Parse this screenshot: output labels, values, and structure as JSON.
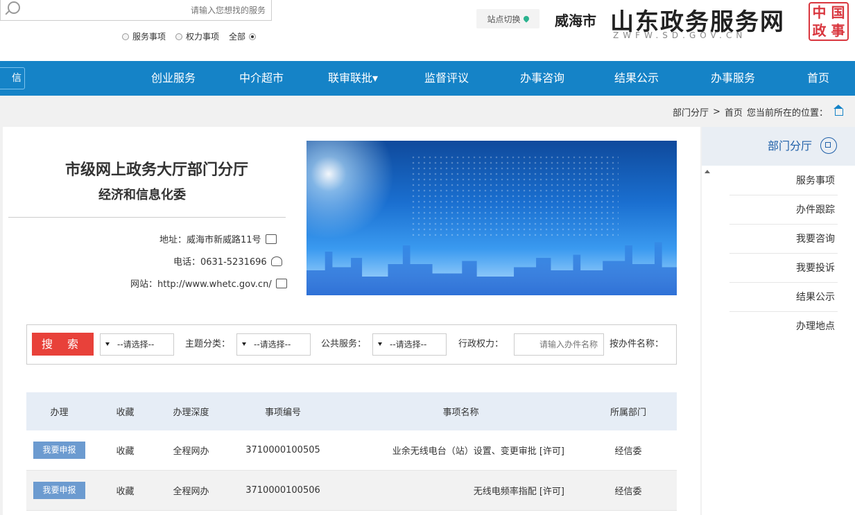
{
  "header": {
    "logo_title": "山东政务服务网",
    "logo_sub": "ZWFW.SD.GOV.CN",
    "seal_chars": [
      "中",
      "国",
      "政",
      "事"
    ],
    "city": "威海市",
    "switch_label": "站点切换",
    "search_placeholder": "请输入您想找的服务",
    "radios": [
      {
        "label": "全部",
        "checked": true
      },
      {
        "label": "权力事项",
        "checked": false
      },
      {
        "label": "服务事项",
        "checked": false
      }
    ]
  },
  "nav": {
    "items": [
      "首页",
      "办事服务",
      "结果公示",
      "办事咨询",
      "监督评议",
      "联审联批▾",
      "中介超市",
      "创业服务"
    ],
    "extra": "信"
  },
  "breadcrumb": {
    "prefix": "您当前所在的位置：",
    "home": "首页",
    "sep": ">",
    "current": "部门分厅"
  },
  "dept": {
    "title": "市级网上政务大厅部门分厅",
    "subtitle": "经济和信息化委",
    "address": "地址：威海市新威路11号",
    "phone": "电话：0631-5231696",
    "website": "网站：http://www.whetc.gov.cn/"
  },
  "filter": {
    "name_label": "按办件名称：",
    "name_placeholder": "请输入办件名称",
    "power_label": "行政权力：",
    "public_label": "公共服务：",
    "theme_label": "主题分类：",
    "select_default": "--请选择--",
    "search_button": "搜 索"
  },
  "table": {
    "headers": [
      "所属部门",
      "事项名称",
      "事项编号",
      "办理深度",
      "收藏",
      "办理"
    ],
    "rows": [
      {
        "dept": "经信委",
        "name": "业余无线电台（站）设置、变更审批 [许可]",
        "code": "371000010050​5",
        "depth": "全程网办",
        "fav": "收藏",
        "action": "我要申报"
      },
      {
        "dept": "经信委",
        "name": "无线电频率指配 [许可]",
        "code": "371000010050​6",
        "depth": "全程网办",
        "fav": "收藏",
        "action": "我要申报"
      }
    ]
  },
  "sidebar": {
    "title": "部门分厅",
    "items": [
      "服务事项",
      "办件跟踪",
      "我要咨询",
      "我要投诉",
      "结果公示",
      "办理地点"
    ]
  },
  "colors": {
    "nav_bg": "#1583c7",
    "search_btn": "#e8413a",
    "apply_btn": "#6c9bd0",
    "sidebar_title": "#1e5fa8"
  }
}
